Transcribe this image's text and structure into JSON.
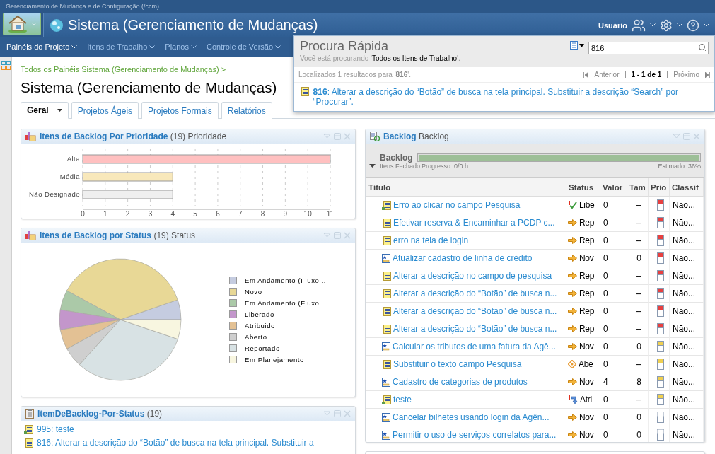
{
  "window": {
    "title": "Gerenciamento de Mudança e de Configuração (/ccm)"
  },
  "header": {
    "project": "Sistema (Gerenciamento de Mudanças)",
    "user": "Usuário"
  },
  "nav": [
    {
      "label": "Painéis do Projeto",
      "selected": true
    },
    {
      "label": "Itens de Trabalho",
      "selected": false
    },
    {
      "label": "Planos",
      "selected": false
    },
    {
      "label": "Controle de Versão",
      "selected": false
    }
  ],
  "breadcrumb": "Todos os Painéis Sistema (Gerenciamento de Mudanças) >",
  "page_title": "Sistema (Gerenciamento de Mudanças)",
  "tabs": [
    {
      "label": "Geral",
      "selected": true
    },
    {
      "label": "Projetos Ágeis",
      "selected": false
    },
    {
      "label": "Projetos Formais",
      "selected": false
    },
    {
      "label": "Relatórios",
      "selected": false
    }
  ],
  "quick_search": {
    "title": "Procura Rápida",
    "scope_text": "Você está procurando '**Todos os Itens de Trabalho**'.",
    "query": "816",
    "results_text": "Localizados 1 resultados para '**816**'.",
    "prev": "Anterior",
    "range": "1 - 1 de 1",
    "next": "Próximo",
    "results": [
      {
        "kind": "task",
        "text": "**816**: Alterar a descrição do “Botão” de busca na tela principal. Substituir a descrição “Search” por “Procurar”."
      }
    ]
  },
  "priority_widget": {
    "title": "Itens de Backlog Por Prioridade",
    "count": "(19)",
    "subtitle": "Prioridade",
    "bars": [
      {
        "color": "#ffc0c0"
      },
      {
        "color": "#f8e8bb"
      },
      {
        "color": "#efefef"
      }
    ],
    "chart_data": {
      "type": "bar",
      "orientation": "horizontal",
      "grid": true,
      "categories": [
        "Alta",
        "Média",
        "Não Designado"
      ],
      "xlim": [
        0,
        11
      ],
      "xticks": [
        0,
        1,
        2,
        3,
        4,
        5,
        6,
        7,
        8,
        9,
        10,
        11
      ],
      "series": [
        {
          "values": [
            11,
            4,
            4
          ]
        }
      ]
    }
  },
  "status_widget": {
    "title": "Itens de Backlog por Status",
    "count": "(19)",
    "subtitle": "Status",
    "slices": [
      {
        "color": "#c5cce0"
      },
      {
        "color": "#e8d896"
      },
      {
        "color": "#abc9a8"
      },
      {
        "color": "#c396cb"
      },
      {
        "color": "#e3c194"
      },
      {
        "color": "#cfcfcf"
      },
      {
        "color": "#d8e2e4"
      },
      {
        "color": "#f8f6e0"
      }
    ],
    "chart_data": {
      "type": "pie",
      "legend": true,
      "categories": [
        "Em Andamento (Fluxo ..",
        "Novo",
        "Em Andamento (Fluxo ..",
        "Liberado",
        "Atribuido",
        "Aberto",
        "Reportado",
        "Em Planejamento"
      ],
      "series": [
        {
          "values": [
            5.3,
            36.8,
            5.3,
            5.3,
            5.3,
            5.3,
            31.5,
            5.2
          ]
        }
      ]
    }
  },
  "list_widget": {
    "title": "ItemDeBacklog-Por-Status",
    "count": "(19)",
    "items": [
      {
        "kind": "task-linked",
        "text": "995: teste"
      },
      {
        "kind": "task",
        "text": "816: Alterar a descrição do “Botão” de busca na tela principal. Substituir a"
      }
    ]
  },
  "backlog_widget": {
    "title": "Backlog",
    "subtitle": "Backlog",
    "group": {
      "name": "Backlog",
      "expanded": true,
      "closed_label": "Itens Fechado",
      "progress_label": "Progresso: 0/0 h",
      "estimate_label": "Estimado: 36%",
      "level": 1
    },
    "columns": [
      "Título",
      "Status",
      "Valor",
      "Tam",
      "Prio",
      "Classif"
    ],
    "rows": [
      {
        "kind": "task-linked",
        "title": "Erro ao clicar no campo Pesquisa",
        "status": {
          "kind": "check",
          "text": "Libe"
        },
        "value": "0",
        "size": "--",
        "priority": {
          "kind": "high"
        },
        "class": "Não..."
      },
      {
        "kind": "task",
        "title": "Efetivar reserva & Encaminhar a PCDP c...",
        "status": {
          "kind": "arrow",
          "text": "Rep"
        },
        "value": "0",
        "size": "--",
        "priority": {
          "kind": "high"
        },
        "class": "Não..."
      },
      {
        "kind": "task",
        "title": "erro na tela de login",
        "status": {
          "kind": "arrow",
          "text": "Rep"
        },
        "value": "0",
        "size": "--",
        "priority": {
          "kind": "high"
        },
        "class": "Não..."
      },
      {
        "kind": "story",
        "title": "Atualizar cadastro de linha de crédito",
        "status": {
          "kind": "arrow",
          "text": "Nov"
        },
        "value": "0",
        "size": "0",
        "priority": {
          "kind": "high"
        },
        "class": "Não..."
      },
      {
        "kind": "task",
        "title": "Alterar a descrição no campo de pesquisa",
        "status": {
          "kind": "arrow",
          "text": "Rep"
        },
        "value": "0",
        "size": "--",
        "priority": {
          "kind": "high"
        },
        "class": "Não..."
      },
      {
        "kind": "task",
        "title": "Alterar a descrição do “Botão” de busca n...",
        "status": {
          "kind": "arrow",
          "text": "Rep"
        },
        "value": "0",
        "size": "--",
        "priority": {
          "kind": "high"
        },
        "class": "Não..."
      },
      {
        "kind": "task",
        "title": "Alterar a descrição do “Botão” de busca n...",
        "status": {
          "kind": "arrow",
          "text": "Rep"
        },
        "value": "0",
        "size": "--",
        "priority": {
          "kind": "high"
        },
        "class": "Não..."
      },
      {
        "kind": "task",
        "title": "Alterar a descrição do “Botão” de busca n...",
        "status": {
          "kind": "arrow",
          "text": "Rep"
        },
        "value": "0",
        "size": "--",
        "priority": {
          "kind": "high"
        },
        "class": "Não..."
      },
      {
        "kind": "story",
        "title": "Calcular os tributos de uma fatura da Agê...",
        "status": {
          "kind": "arrow",
          "text": "Nov"
        },
        "value": "0",
        "size": "0",
        "priority": {
          "kind": "medium"
        },
        "class": "Não..."
      },
      {
        "kind": "task",
        "title": "Substituir o texto campo Pesquisa",
        "status": {
          "kind": "diamond",
          "text": "Abe"
        },
        "value": "0",
        "size": "--",
        "priority": {
          "kind": "medium"
        },
        "class": "Não..."
      },
      {
        "kind": "story",
        "title": "Cadastro de categorias de produtos",
        "status": {
          "kind": "arrow",
          "text": "Nov"
        },
        "value": "4",
        "size": "8",
        "priority": {
          "kind": "medium"
        },
        "class": "Não..."
      },
      {
        "kind": "task-linked",
        "title": "teste",
        "status": {
          "kind": "swap",
          "text": "Atri"
        },
        "value": "0",
        "size": "--",
        "priority": {
          "kind": "medium"
        },
        "class": "Não..."
      },
      {
        "kind": "story",
        "title": "Cancelar  bilhetes usando login da Agên...",
        "status": {
          "kind": "arrow",
          "text": "Nov"
        },
        "value": "0",
        "size": "0",
        "priority": {
          "kind": "none"
        },
        "class": "Não..."
      },
      {
        "kind": "story",
        "title": "Permitir o uso de serviços correlatos para...",
        "status": {
          "kind": "arrow",
          "text": "Nov"
        },
        "value": "0",
        "size": "0",
        "priority": {
          "kind": "none"
        },
        "class": "Não..."
      }
    ]
  }
}
